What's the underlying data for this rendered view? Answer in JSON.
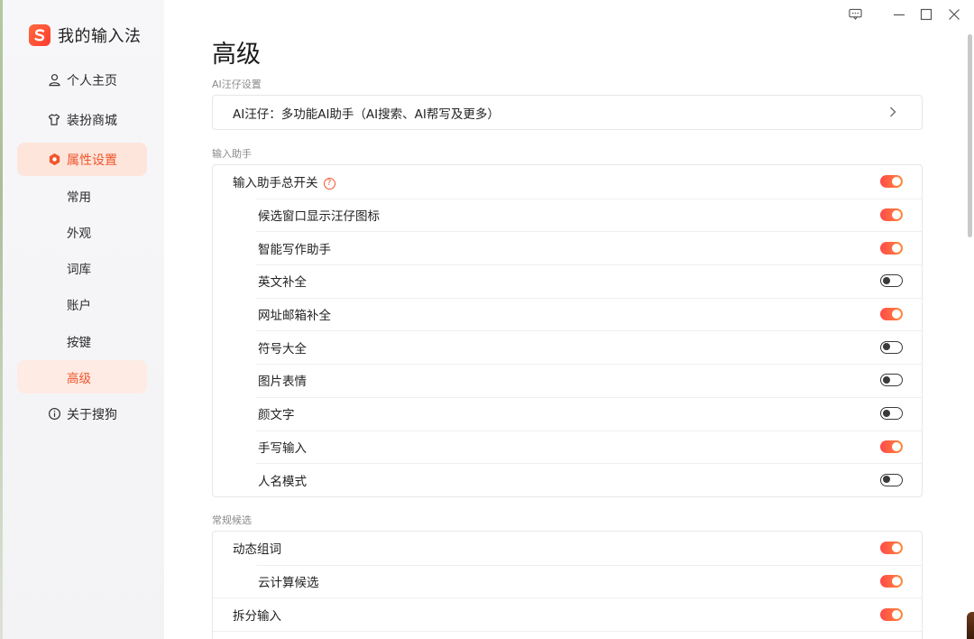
{
  "app": {
    "title": "我的输入法"
  },
  "sidebar": {
    "items": [
      {
        "label": "个人主页",
        "icon": "user-icon"
      },
      {
        "label": "装扮商城",
        "icon": "shirt-icon"
      },
      {
        "label": "属性设置",
        "icon": "settings-hex-icon",
        "active": true
      },
      {
        "label": "常用"
      },
      {
        "label": "外观"
      },
      {
        "label": "词库"
      },
      {
        "label": "账户"
      },
      {
        "label": "按键"
      },
      {
        "label": "高级",
        "active": true
      },
      {
        "label": "关于搜狗",
        "icon": "info-icon"
      }
    ]
  },
  "page": {
    "title": "高级"
  },
  "sections": [
    {
      "label": "AI汪仔设置",
      "rows": [
        {
          "label": "AI汪仔：多功能AI助手（AI搜索、AI帮写及更多）",
          "control": "chevron"
        }
      ]
    },
    {
      "label": "输入助手",
      "rows": [
        {
          "label": "输入助手总开关",
          "on": true,
          "help": "?"
        },
        {
          "label": "候选窗口显示汪仔图标",
          "on": true,
          "indent": true
        },
        {
          "label": "智能写作助手",
          "on": true,
          "indent": true
        },
        {
          "label": "英文补全",
          "on": false,
          "indent": true
        },
        {
          "label": "网址邮箱补全",
          "on": true,
          "indent": true
        },
        {
          "label": "符号大全",
          "on": false,
          "indent": true
        },
        {
          "label": "图片表情",
          "on": false,
          "indent": true
        },
        {
          "label": "颜文字",
          "on": false,
          "indent": true
        },
        {
          "label": "手写输入",
          "on": true,
          "indent": true
        },
        {
          "label": "人名模式",
          "on": false,
          "indent": true
        }
      ]
    },
    {
      "label": "常规候选",
      "rows": [
        {
          "label": "动态组词",
          "on": true
        },
        {
          "label": "云计算候选",
          "on": true,
          "indent": true
        },
        {
          "label": "拆分输入",
          "on": true
        }
      ]
    }
  ],
  "colors": {
    "accent": "#f0552a",
    "toggle_on_start": "#ff4a4a",
    "toggle_on_end": "#ff8a3a"
  }
}
